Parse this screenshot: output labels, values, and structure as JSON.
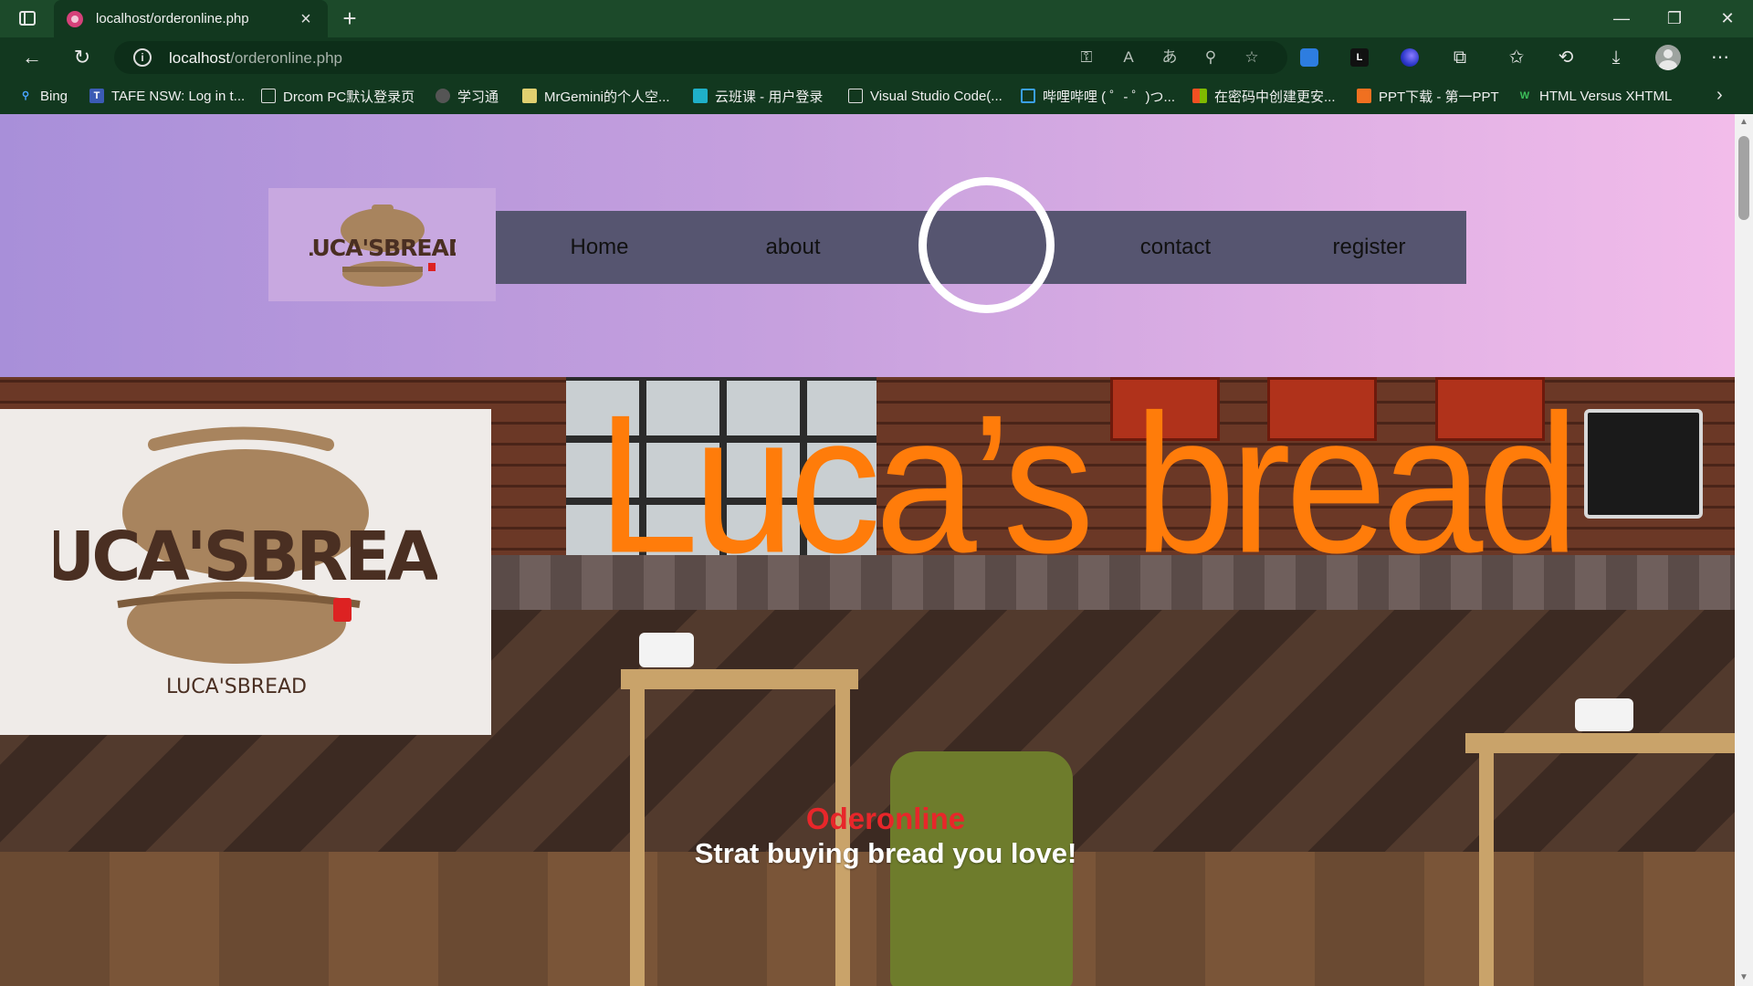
{
  "browser": {
    "tab_title": "localhost/orderonline.php",
    "address_host": "localhost",
    "address_path": "/orderonline.php",
    "favorites": [
      {
        "label": "Bing"
      },
      {
        "label": "TAFE NSW: Log in t..."
      },
      {
        "label": "Drcom PC默认登录页"
      },
      {
        "label": "学习通"
      },
      {
        "label": "MrGemini的个人空..."
      },
      {
        "label": "云班课 - 用户登录"
      },
      {
        "label": "Visual Studio Code(..."
      },
      {
        "label": "哔哩哔哩 ( ゜- ゜)つ..."
      },
      {
        "label": "在密码中创建更安..."
      },
      {
        "label": "PPT下载 - 第一PPT"
      },
      {
        "label": "HTML Versus XHTML"
      }
    ]
  },
  "header": {
    "logo_text": "LUCA'SBREAD",
    "nav": [
      {
        "label": "Home"
      },
      {
        "label": "about"
      },
      {
        "label": "contact"
      },
      {
        "label": "register"
      }
    ]
  },
  "hero": {
    "logo_text": "LUCA'SBREAD",
    "logo_caption": "LUCA'SBREAD",
    "brand_title": "Luca’s bread",
    "section_title": "Oderonline",
    "tagline": "Strat buying bread you love!"
  },
  "colors": {
    "header_gradient_start": "#a88fd9",
    "header_gradient_end": "#f2bcea",
    "nav_bg": "#565570",
    "brand_orange": "#ff7c0a",
    "section_title_red": "#e8262a",
    "logo_brown": "#4a2f22",
    "pot_tan": "#a8845e"
  }
}
